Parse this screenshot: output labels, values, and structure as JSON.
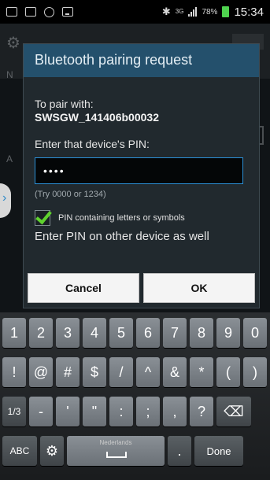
{
  "status_bar": {
    "network": "3G",
    "battery_percent": "78%",
    "time": "15:34"
  },
  "background": {
    "letter_1": "N",
    "letter_2": "A"
  },
  "dialog": {
    "title": "Bluetooth pairing request",
    "to_pair_label": "To pair with:",
    "device_name": "SWSGW_141406b00032",
    "enter_pin_label": "Enter that device's PIN:",
    "pin_value": "••••",
    "hint": "(Try 0000 or 1234)",
    "checkbox_label": "PIN containing letters or symbols",
    "checkbox_checked": true,
    "also_text": "Enter PIN on other device as well",
    "cancel_label": "Cancel",
    "ok_label": "OK"
  },
  "keyboard": {
    "row1": [
      "1",
      "2",
      "3",
      "4",
      "5",
      "6",
      "7",
      "8",
      "9",
      "0"
    ],
    "row2": [
      "!",
      "@",
      "#",
      "$",
      "/",
      "^",
      "&",
      "*",
      "(",
      ")"
    ],
    "row3": [
      "1/3",
      "-",
      "'",
      "\"",
      ":",
      ";",
      ",",
      "?",
      "⌫"
    ],
    "row4": {
      "abc": "ABC",
      "space_lang": "Nederlands",
      "period": ".",
      "done": "Done"
    }
  }
}
